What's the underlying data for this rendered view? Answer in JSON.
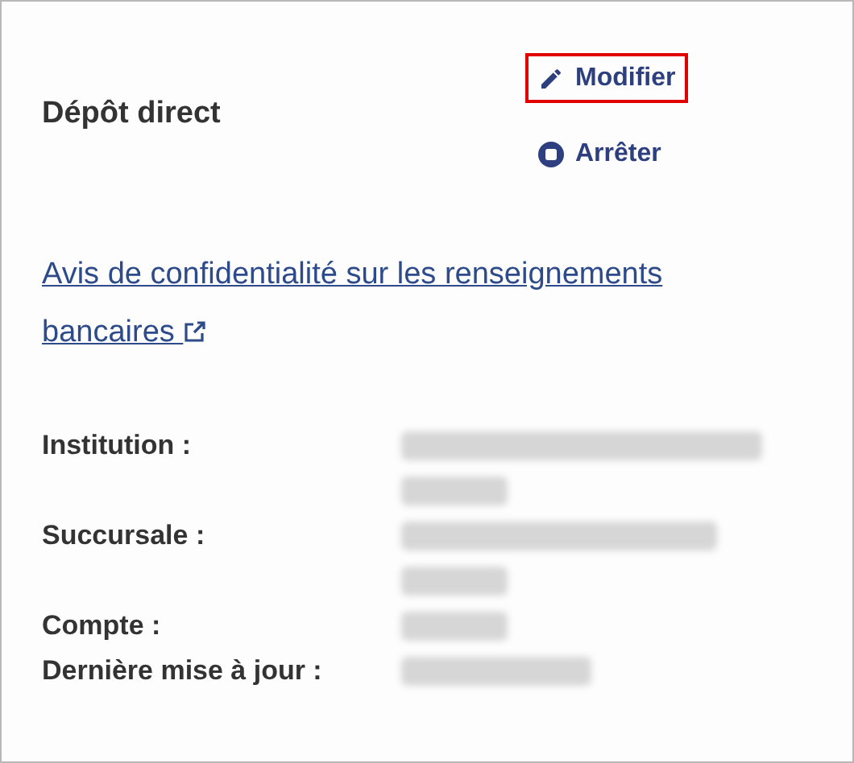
{
  "title": "Dépôt direct",
  "actions": [
    {
      "kind": "edit",
      "label": "Modifier",
      "highlighted": true
    },
    {
      "kind": "stop",
      "label": "Arrêter",
      "highlighted": false
    }
  ],
  "privacy_link": {
    "text": "Avis de confidentialité sur les renseignements bancaires",
    "external": true
  },
  "details": [
    {
      "label": "Institution :",
      "values": [
        {
          "kind": "long"
        },
        {
          "kind": "short"
        }
      ]
    },
    {
      "label": "Succursale :",
      "values": [
        {
          "kind": "medium"
        },
        {
          "kind": "short"
        }
      ]
    },
    {
      "label": "Compte :",
      "values": [
        {
          "kind": "short"
        }
      ]
    },
    {
      "label": "Dernière mise à jour :",
      "values": [
        {
          "kind": "date"
        }
      ]
    }
  ]
}
